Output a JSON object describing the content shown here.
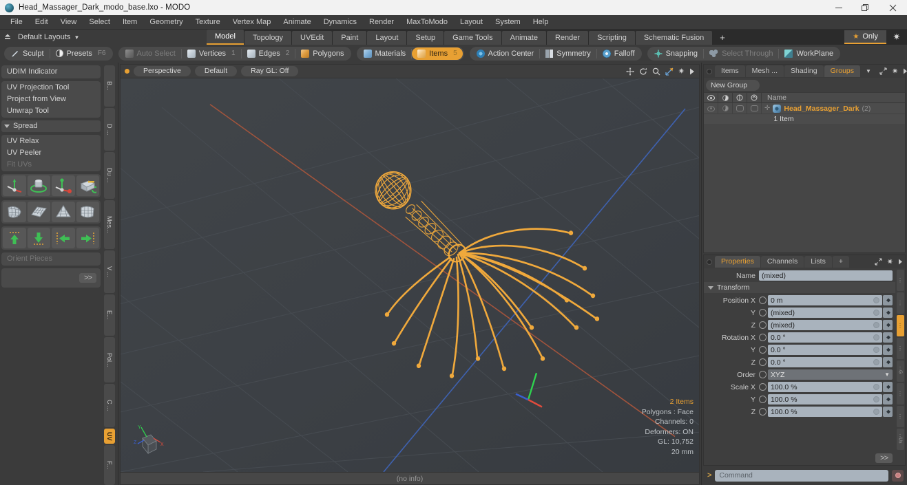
{
  "titlebar": {
    "title": "Head_Massager_Dark_modo_base.lxo - MODO",
    "minimize": "minimize-button",
    "maximize": "maximize-button",
    "close": "close-button"
  },
  "menubar": {
    "items": [
      "File",
      "Edit",
      "View",
      "Select",
      "Item",
      "Geometry",
      "Texture",
      "Vertex Map",
      "Animate",
      "Dynamics",
      "Render",
      "MaxToModo",
      "Layout",
      "System",
      "Help"
    ]
  },
  "layoutbar": {
    "layouts_label": "Default Layouts",
    "tabs": [
      {
        "label": "Model",
        "active": true
      },
      {
        "label": "Topology",
        "active": false
      },
      {
        "label": "UVEdit",
        "active": false
      },
      {
        "label": "Paint",
        "active": false
      },
      {
        "label": "Layout",
        "active": false
      },
      {
        "label": "Setup",
        "active": false
      },
      {
        "label": "Game Tools",
        "active": false
      },
      {
        "label": "Animate",
        "active": false
      },
      {
        "label": "Render",
        "active": false
      },
      {
        "label": "Scripting",
        "active": false
      },
      {
        "label": "Schematic Fusion",
        "active": false
      }
    ],
    "add_label": "+",
    "only_label": "Only"
  },
  "modebar": {
    "left": [
      {
        "label": "Sculpt",
        "icon": "pencil-icon",
        "dim": false
      },
      {
        "label": "Presets",
        "icon": "presets-icon",
        "dim": false,
        "shortcut": "F6"
      }
    ],
    "selection_modes": [
      {
        "label": "Auto Select",
        "num": "",
        "state": "dim",
        "icon": "cube-grey-icon"
      },
      {
        "label": "Vertices",
        "num": "1",
        "state": "normal",
        "icon": "cube-white-icon"
      },
      {
        "label": "Edges",
        "num": "2",
        "state": "normal",
        "icon": "cube-white-icon"
      },
      {
        "label": "Polygons",
        "num": "",
        "state": "normal",
        "icon": "cube-orange-icon"
      }
    ],
    "item_modes": [
      {
        "label": "Materials",
        "num": "",
        "state": "normal",
        "icon": "cube-blue-icon"
      },
      {
        "label": "Items",
        "num": "5",
        "state": "selected",
        "icon": "cube-sel-icon"
      }
    ],
    "tools": [
      {
        "label": "Action Center",
        "icon": "action-center-icon",
        "dim": false
      },
      {
        "label": "Symmetry",
        "icon": "symmetry-icon",
        "dim": false
      },
      {
        "label": "Falloff",
        "icon": "falloff-icon",
        "dim": false
      }
    ],
    "snap_tools": [
      {
        "label": "Snapping",
        "icon": "snapping-icon",
        "dim": false
      },
      {
        "label": "Select Through",
        "icon": "select-through-icon",
        "dim": true
      },
      {
        "label": "WorkPlane",
        "icon": "workplane-icon",
        "dim": false
      }
    ]
  },
  "left_panel": {
    "groups": [
      {
        "rows": [
          {
            "label": "UDIM Indicator",
            "dim": false
          }
        ]
      },
      {
        "rows": [
          {
            "label": "UV Projection Tool",
            "dim": false
          },
          {
            "label": "Project from View",
            "dim": false
          },
          {
            "label": "Unwrap Tool",
            "dim": false
          }
        ]
      },
      {
        "header": "Spread"
      },
      {
        "rows": [
          {
            "label": "UV Relax",
            "dim": false
          },
          {
            "label": "UV Peeler",
            "dim": false
          },
          {
            "label": "Fit UVs",
            "dim": true
          }
        ]
      }
    ],
    "icon_rows": [
      [
        "uv-move-axis-icon",
        "uv-rotate-icon",
        "uv-scale-icon",
        "uv-project-cube-icon"
      ],
      [
        "uv-relax-mesh-icon",
        "uv-flatten-grid-icon",
        "uv-cone-unwrap-icon",
        "uv-peel-patch-icon"
      ],
      [
        "uv-align-up-icon",
        "uv-align-down-icon",
        "uv-align-left-icon",
        "uv-align-right-icon"
      ]
    ],
    "orient_label": "Orient Pieces",
    "more_label": ">>",
    "vtabs": [
      {
        "label": "B...",
        "active": false
      },
      {
        "label": "D ...",
        "active": false
      },
      {
        "label": "Du ...",
        "active": false
      },
      {
        "label": "Mes...",
        "active": false
      },
      {
        "label": "V ...",
        "active": false
      },
      {
        "label": "E...",
        "active": false
      },
      {
        "label": "Pol...",
        "active": false
      },
      {
        "label": "C ...",
        "active": false
      },
      {
        "label": "UV",
        "active": true
      },
      {
        "label": "F...",
        "active": false
      }
    ]
  },
  "viewport": {
    "header": {
      "view_mode": "Perspective",
      "shading": "Default",
      "ray_gl": "Ray GL: Off",
      "tools": [
        "move-icon",
        "rotate-icon",
        "zoom-icon",
        "fit-icon",
        "gear-icon",
        "arrow-icon"
      ]
    },
    "stats": {
      "items": "2 Items",
      "polygons": "Polygons : Face",
      "channels": "Channels: 0",
      "deformers": "Deformers: ON",
      "gl": "GL: 10,752",
      "grid": "20 mm"
    },
    "axis": {
      "x": "X",
      "y": "Y",
      "z": "Z"
    },
    "model_name": "head-massager-wireframe"
  },
  "statusbar": {
    "info": "(no info)"
  },
  "right_panel": {
    "top_tabs": [
      {
        "label": "Items",
        "active": false
      },
      {
        "label": "Mesh ...",
        "active": false
      },
      {
        "label": "Shading",
        "active": false
      },
      {
        "label": "Groups",
        "active": true
      }
    ],
    "new_group_label": "New Group",
    "tree_headers": [
      "visible-col",
      "shadow-col",
      "render-col",
      "lock-col",
      "Name"
    ],
    "tree_rows": [
      {
        "name": "Head_Massager_Dark",
        "count": "(2)",
        "sub": "1 Item"
      }
    ],
    "props_tabs": [
      {
        "label": "Properties",
        "active": true
      },
      {
        "label": "Channels",
        "active": false
      },
      {
        "label": "Lists",
        "active": false
      },
      {
        "label": "+",
        "active": false
      }
    ],
    "properties": {
      "name_label": "Name",
      "name_value": "(mixed)",
      "transform_section": "Transform",
      "fields": [
        {
          "label": "Position X",
          "value": "0 m",
          "type": "num"
        },
        {
          "label": "Y",
          "value": "(mixed)",
          "type": "num"
        },
        {
          "label": "Z",
          "value": "(mixed)",
          "type": "num"
        },
        {
          "label": "Rotation X",
          "value": "0.0 °",
          "type": "num"
        },
        {
          "label": "Y",
          "value": "0.0 °",
          "type": "num"
        },
        {
          "label": "Z",
          "value": "0.0 °",
          "type": "num"
        },
        {
          "label": "Order",
          "value": "XYZ",
          "type": "select"
        },
        {
          "label": "Scale X",
          "value": "100.0 %",
          "type": "num"
        },
        {
          "label": "Y",
          "value": "100.0 %",
          "type": "num"
        },
        {
          "label": "Z",
          "value": "100.0 %",
          "type": "num"
        }
      ],
      "more_label": ">>",
      "side_tabs": [
        {
          "label": "",
          "active": false
        },
        {
          "label": "",
          "active": false
        },
        {
          "label": "",
          "active": true
        },
        {
          "label": "",
          "active": false
        },
        {
          "label": "G",
          "active": false
        },
        {
          "label": "",
          "active": false
        },
        {
          "label": "",
          "active": false
        },
        {
          "label": "Us",
          "active": false
        }
      ]
    }
  },
  "command_bar": {
    "prompt": ">",
    "placeholder": "Command",
    "record": "record-button"
  },
  "colors": {
    "accent": "#e8a033",
    "panel_bg": "#3b3b3b",
    "viewport_bg": "#3c4045",
    "field_bg": "#a9b3bd",
    "wireframe": "#f0a93c"
  }
}
